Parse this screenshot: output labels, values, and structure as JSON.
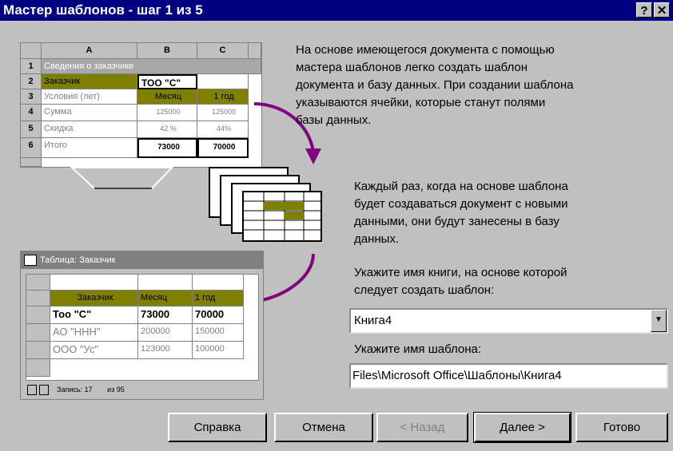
{
  "window": {
    "title": "Мастер шаблонов - шаг 1 из 5",
    "help_glyph": "?",
    "close_glyph": "✕"
  },
  "description1": [
    "На основе имеющегося документа с помощью",
    "мастера шаблонов легко создать шаблон",
    "документа и базу данных. При создании шаблона",
    "указываются ячейки, которые станут полями",
    "базы данных."
  ],
  "description2": [
    "Каждый раз, когда на основе шаблона",
    "будет создаваться документ с новыми",
    "данными, они будут занесены в базу",
    "данных."
  ],
  "workbook": {
    "label_lines": [
      "Укажите имя книги, на основе которой",
      "следует создать шаблон:"
    ],
    "value": "Книга4",
    "dropdown_icon": "▼"
  },
  "template_name": {
    "label": "Укажите имя шаблона:",
    "value": "Files\\Microsoft Office\\Шаблоны\\Книга4"
  },
  "buttons": {
    "help": "Справка",
    "cancel": "Отмена",
    "back": "< Назад",
    "next": "Далее >",
    "finish": "Готово"
  },
  "illustration": {
    "columns": [
      "A",
      "B",
      "C"
    ],
    "row_numbers": [
      "1",
      "2",
      "3",
      "4",
      "5",
      "6"
    ],
    "row1": "Сведения о заказчике",
    "rows": [
      [
        "Заказчик",
        "ТОО \"С\"",
        ""
      ],
      [
        "Условия (лет)",
        "Месяц",
        "1 год"
      ],
      [
        "Сумма",
        "125000",
        "125000"
      ],
      [
        "Скидка",
        "42 %",
        "44%"
      ],
      [
        "Итого",
        "73000",
        "70000"
      ]
    ],
    "table_title": "Таблица: Заказчик",
    "table_header": [
      "Заказчик",
      "Месяц",
      "1 год"
    ],
    "table_rows": [
      [
        "Тоо \"С\"",
        "73000",
        "70000"
      ],
      [
        "АО \"ННН\"",
        "200000",
        "150000"
      ],
      [
        "ООО \"Ус\"",
        "123000",
        "100000"
      ]
    ],
    "nav_text": "Запись: 17",
    "nav_of": "из 95"
  }
}
